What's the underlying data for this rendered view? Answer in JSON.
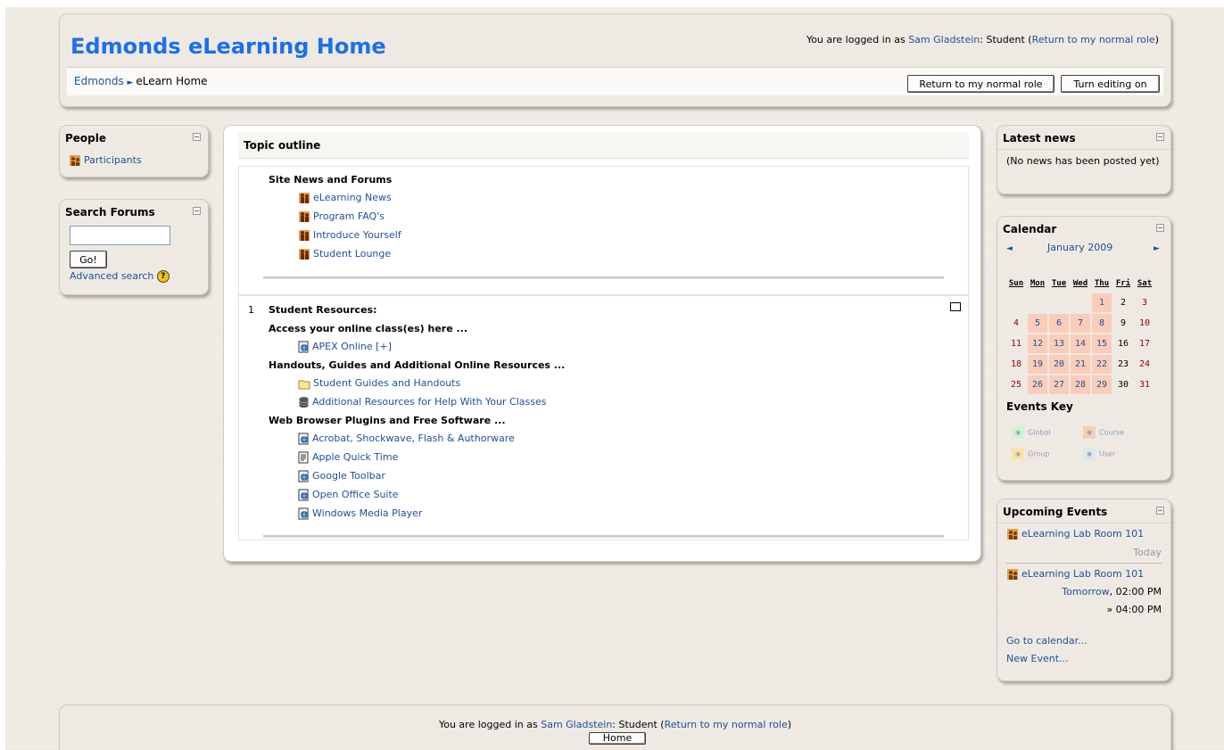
{
  "header": {
    "site_title": "Edmonds eLearning Home",
    "login_prefix": "You are logged in as",
    "login_user": "Sam Gladstein",
    "login_role": ": Student (",
    "login_return_link": "Return to my normal role",
    "login_suffix": ")",
    "breadcrumb_root": "Edmonds",
    "breadcrumb_current": "eLearn Home",
    "return_button": "Return to my normal role",
    "editing_button": "Turn editing on"
  },
  "people_block": {
    "title": "People",
    "participants": "Participants"
  },
  "search_block": {
    "title": "Search Forums",
    "go_button": "Go!",
    "advanced_link": "Advanced search"
  },
  "topic_outline": {
    "title": "Topic outline",
    "section0": {
      "heading": "Site News and Forums",
      "items": [
        "eLearning News",
        "Program FAQ's",
        "Introduce Yourself",
        "Student Lounge"
      ]
    },
    "section1": {
      "number": "1",
      "heading": "Student Resources:",
      "sub1": "Access your online class(es) here ...",
      "sub1_items": [
        "APEX Online [+]"
      ],
      "sub2": "Handouts, Guides and Additional Online Resources ...",
      "sub2_items": [
        "Student Guides and Handouts",
        "Additional Resources for Help With Your Classes"
      ],
      "sub3": "Web Browser Plugins and Free Software ...",
      "sub3_items": [
        "Acrobat, Shockwave, Flash & Authorware",
        "Apple Quick Time",
        "Google Toolbar",
        "Open Office Suite",
        "Windows Media Player"
      ]
    }
  },
  "latest_news": {
    "title": "Latest news",
    "text": "(No news has been posted yet)"
  },
  "calendar": {
    "title": "Calendar",
    "month": "January 2009",
    "prev": "◄",
    "next": "►",
    "weekdays": [
      "Sun",
      "Mon",
      "Tue",
      "Wed",
      "Thu",
      "Fri",
      "Sat"
    ],
    "weeks": [
      [
        "",
        "",
        "",
        "",
        "1",
        "2",
        "3"
      ],
      [
        "4",
        "5",
        "6",
        "7",
        "8",
        "9",
        "10"
      ],
      [
        "11",
        "12",
        "13",
        "14",
        "15",
        "16",
        "17"
      ],
      [
        "18",
        "19",
        "20",
        "21",
        "22",
        "23",
        "24"
      ],
      [
        "25",
        "26",
        "27",
        "28",
        "29",
        "30",
        "31"
      ]
    ],
    "event_days": [
      "1",
      "5",
      "6",
      "7",
      "8",
      "12",
      "13",
      "14",
      "15",
      "19",
      "20",
      "21",
      "22",
      "26",
      "27",
      "28",
      "29"
    ],
    "events_key_title": "Events Key",
    "key": {
      "global": "Global",
      "course": "Course",
      "group": "Group",
      "user": "User"
    },
    "key_colors": {
      "global": "#d4f2d0",
      "course": "#f9cdb9",
      "group": "#fbe3a8",
      "user": "#dce7f0"
    }
  },
  "upcoming": {
    "title": "Upcoming Events",
    "event1_name": "eLearning Lab Room 101",
    "event1_when": "Today",
    "event2_name": "eLearning Lab Room 101",
    "event2_day": "Tomorrow",
    "event2_time": ", 02:00 PM",
    "event2_end": "» 04:00 PM",
    "go_calendar": "Go to calendar...",
    "new_event": "New Event..."
  },
  "footer": {
    "login_prefix": "You are logged in as",
    "login_user": "Sam Gladstein",
    "login_role": ": Student (",
    "login_return_link": "Return to my normal role",
    "login_suffix": ")",
    "home_button": "Home"
  }
}
